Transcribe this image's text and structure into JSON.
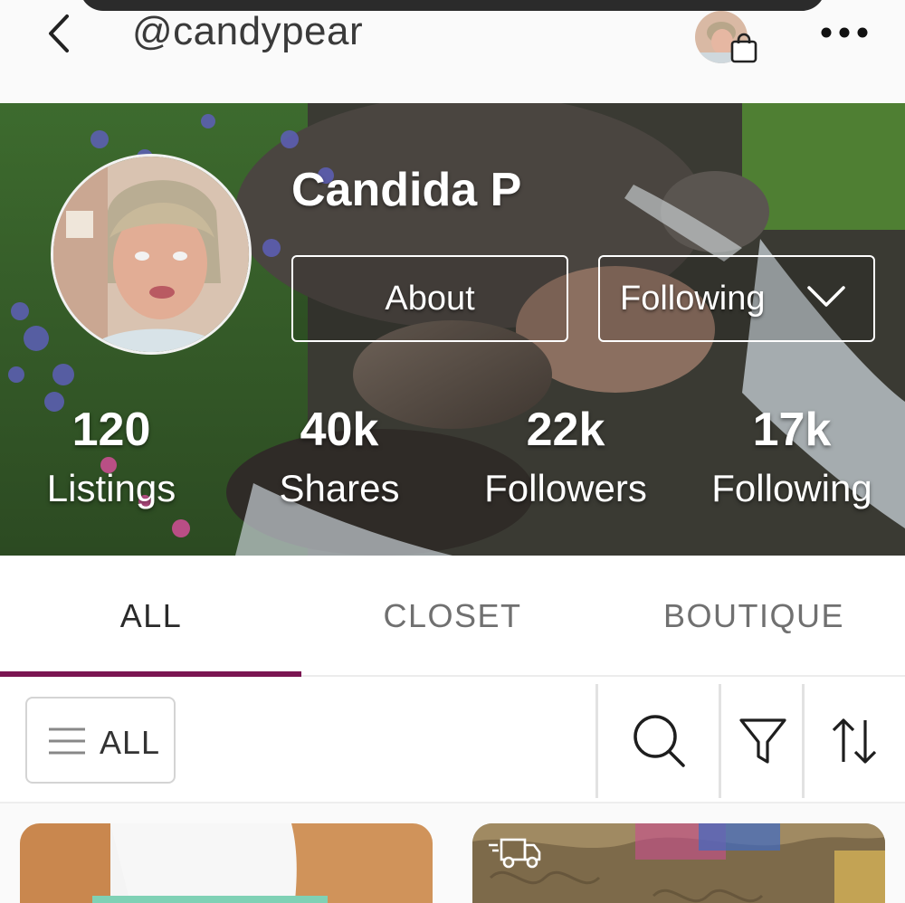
{
  "header": {
    "username": "@candypear"
  },
  "profile": {
    "display_name": "Candida P",
    "about_label": "About",
    "following_label": "Following"
  },
  "stats": [
    {
      "value": "120",
      "label": "Listings"
    },
    {
      "value": "40k",
      "label": "Shares"
    },
    {
      "value": "22k",
      "label": "Followers"
    },
    {
      "value": "17k",
      "label": "Following"
    }
  ],
  "tabs": [
    {
      "label": "ALL",
      "active": true
    },
    {
      "label": "CLOSET",
      "active": false
    },
    {
      "label": "BOUTIQUE",
      "active": false
    }
  ],
  "filter": {
    "all_label": "ALL"
  },
  "icons": [
    "back-icon",
    "shopping-bag-icon",
    "more-icon",
    "chevron-down-icon",
    "menu-icon",
    "search-icon",
    "filter-icon",
    "sort-icon",
    "shipping-truck-icon"
  ],
  "colors": {
    "accent": "#7b1552",
    "text": "#2a2a2a",
    "muted_tab": "#707070"
  }
}
